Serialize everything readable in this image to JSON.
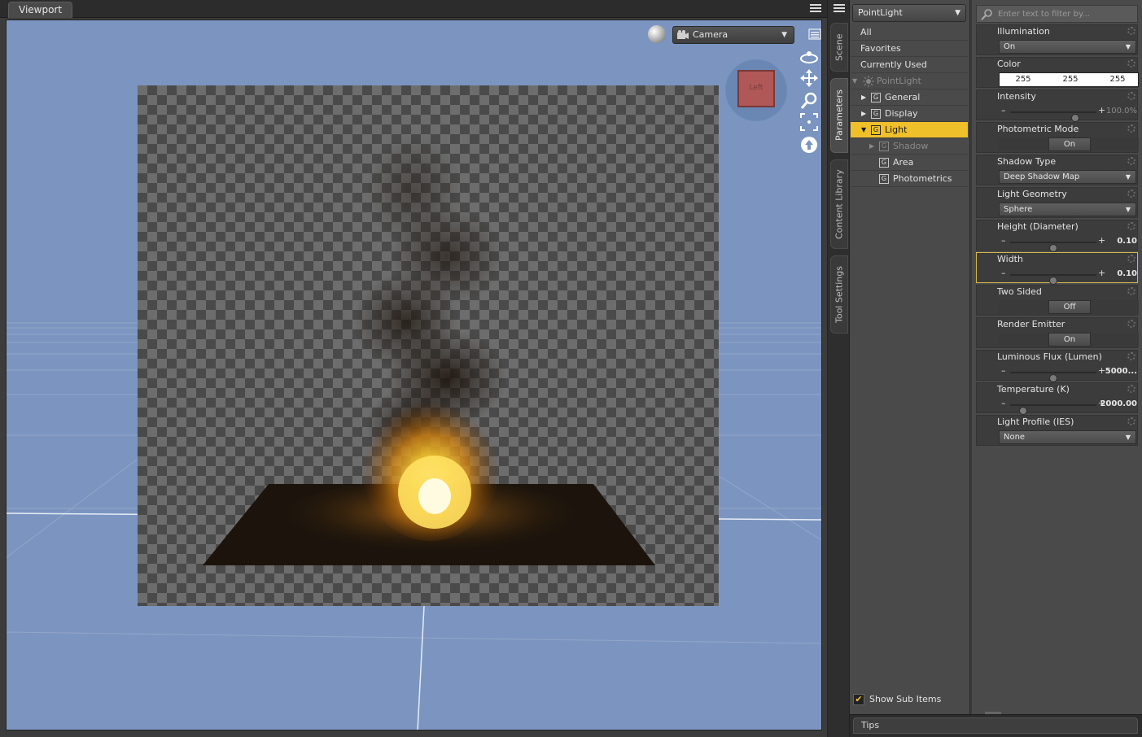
{
  "viewport": {
    "tab_label": "Viewport",
    "camera_label": "Camera",
    "view_cube_label": "Left"
  },
  "side_tabs": [
    "Scene",
    "Parameters",
    "Content Library",
    "Tool Settings"
  ],
  "tree": {
    "node_name": "PointLight",
    "rows": [
      {
        "label": "All"
      },
      {
        "label": "Favorites"
      },
      {
        "label": "Currently Used"
      },
      {
        "label": "PointLight"
      },
      {
        "label": "General"
      },
      {
        "label": "Display"
      },
      {
        "label": "Light"
      },
      {
        "label": "Shadow"
      },
      {
        "label": "Area"
      },
      {
        "label": "Photometrics"
      }
    ],
    "show_sub_items": "Show Sub Items"
  },
  "filter": {
    "placeholder": "Enter text to filter by..."
  },
  "properties": [
    {
      "label": "Illumination",
      "value": "On"
    },
    {
      "label": "Color",
      "r": "255",
      "g": "255",
      "b": "255"
    },
    {
      "label": "Intensity",
      "value": "100.0%",
      "fraction": 0.75
    },
    {
      "label": "Photometric Mode",
      "value": "On"
    },
    {
      "label": "Shadow Type",
      "value": "Deep Shadow Map"
    },
    {
      "label": "Light Geometry",
      "value": "Sphere"
    },
    {
      "label": "Height (Diameter)",
      "value": "0.10",
      "fraction": 0.5
    },
    {
      "label": "Width",
      "value": "0.10",
      "fraction": 0.5
    },
    {
      "label": "Two Sided",
      "value": "Off"
    },
    {
      "label": "Render Emitter",
      "value": "On"
    },
    {
      "label": "Luminous Flux (Lumen)",
      "value": "5000...",
      "fraction": 0.5
    },
    {
      "label": "Temperature (K)",
      "value": "2000.00",
      "fraction": 0.15
    },
    {
      "label": "Light Profile (IES)",
      "value": "None"
    }
  ],
  "tips": {
    "label": "Tips"
  },
  "colors": {
    "accent": "#f0c02a",
    "viewport_bg": "#7b95c0",
    "highlight_border": "#d6b84a"
  }
}
